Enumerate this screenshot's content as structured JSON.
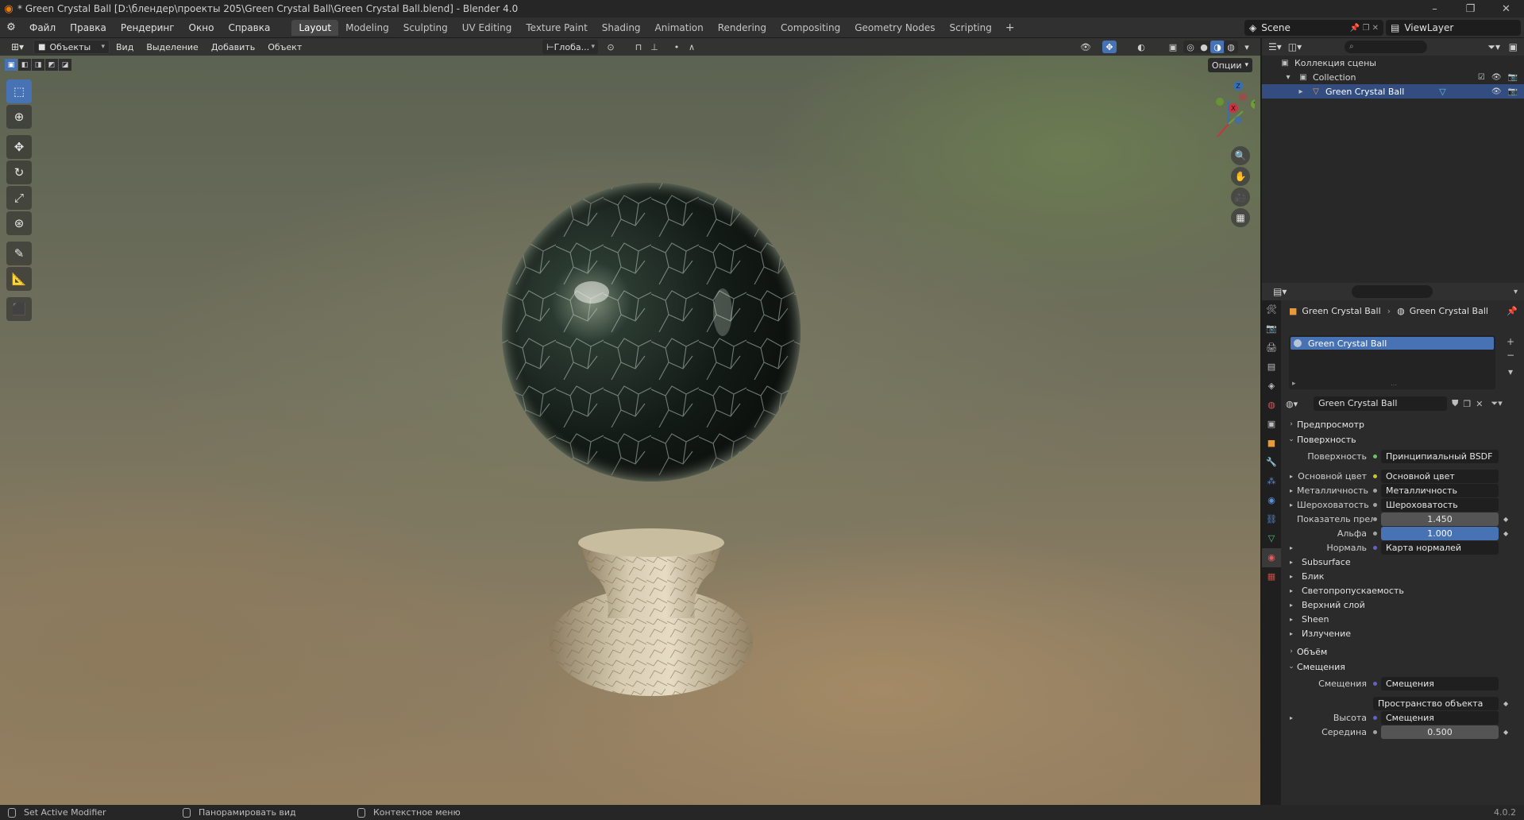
{
  "window": {
    "title": "* Green Crystal Ball [D:\\блендер\\проекты 205\\Green Crystal Ball\\Green Crystal Ball.blend] - Blender 4.0",
    "controls": [
      "–",
      "❐",
      "✕"
    ]
  },
  "menubar": {
    "items": [
      "Файл",
      "Правка",
      "Рендеринг",
      "Окно",
      "Справка"
    ],
    "workspaces": [
      "Layout",
      "Modeling",
      "Sculpting",
      "UV Editing",
      "Texture Paint",
      "Shading",
      "Animation",
      "Rendering",
      "Compositing",
      "Geometry Nodes",
      "Scripting"
    ],
    "active_workspace": "Layout",
    "add_tab": "+",
    "scene": "Scene",
    "view_layer": "ViewLayer"
  },
  "viewport": {
    "mode": "Объекты",
    "menus": [
      "Вид",
      "Выделение",
      "Добавить",
      "Объект"
    ],
    "transform_orientation": "Глоба...",
    "options_label": "Опции",
    "gizmo_axes": {
      "x": "X",
      "y": "Y",
      "z": "Z"
    }
  },
  "outliner": {
    "scene_collection": "Коллекция сцены",
    "collection": "Collection",
    "object": "Green Crystal Ball"
  },
  "properties": {
    "breadcrumb_object": "Green Crystal Ball",
    "breadcrumb_material": "Green Crystal Ball",
    "slot_name": "Green Crystal Ball",
    "material_name": "Green Crystal Ball",
    "panels": {
      "preview": "Предпросмотр",
      "surface": "Поверхность",
      "volume": "Объём",
      "displacement": "Смещения"
    },
    "surface_rows": [
      {
        "label": "Поверхность",
        "value": "Принципиальный BSDF",
        "socket": "#63c763",
        "expand": false
      },
      {
        "label": "Основной цвет",
        "value": "Основной цвет",
        "socket": "#c7c729",
        "expand": true
      },
      {
        "label": "Металличность",
        "value": "Металличность",
        "socket": "#a1a1a1",
        "expand": true
      },
      {
        "label": "Шероховатость",
        "value": "Шероховатость",
        "socket": "#a1a1a1",
        "expand": true
      },
      {
        "label": "Показатель прело...",
        "value": "1.450",
        "socket": "#a1a1a1",
        "expand": false,
        "numeric": true
      },
      {
        "label": "Альфа",
        "value": "1.000",
        "socket": "#a1a1a1",
        "expand": false,
        "numeric": true,
        "highlight": true
      },
      {
        "label": "Нормаль",
        "value": "Карта нормалей",
        "socket": "#6363c7",
        "expand": true
      }
    ],
    "subpanels": [
      "Subsurface",
      "Блик",
      "Светопропускаемость",
      "Верхний слой",
      "Sheen",
      "Излучение"
    ],
    "displacement_rows": {
      "displacement_label": "Смещения",
      "displacement_value": "Смещения",
      "space_value": "Пространство объекта",
      "height_label": "Высота",
      "height_value": "Смещения",
      "midlevel_label": "Середина",
      "midlevel_value": "0.500"
    }
  },
  "statusbar": {
    "items": [
      "Set Active Modifier",
      "Панорамировать вид",
      "Контекстное меню"
    ],
    "version": "4.0.2"
  }
}
